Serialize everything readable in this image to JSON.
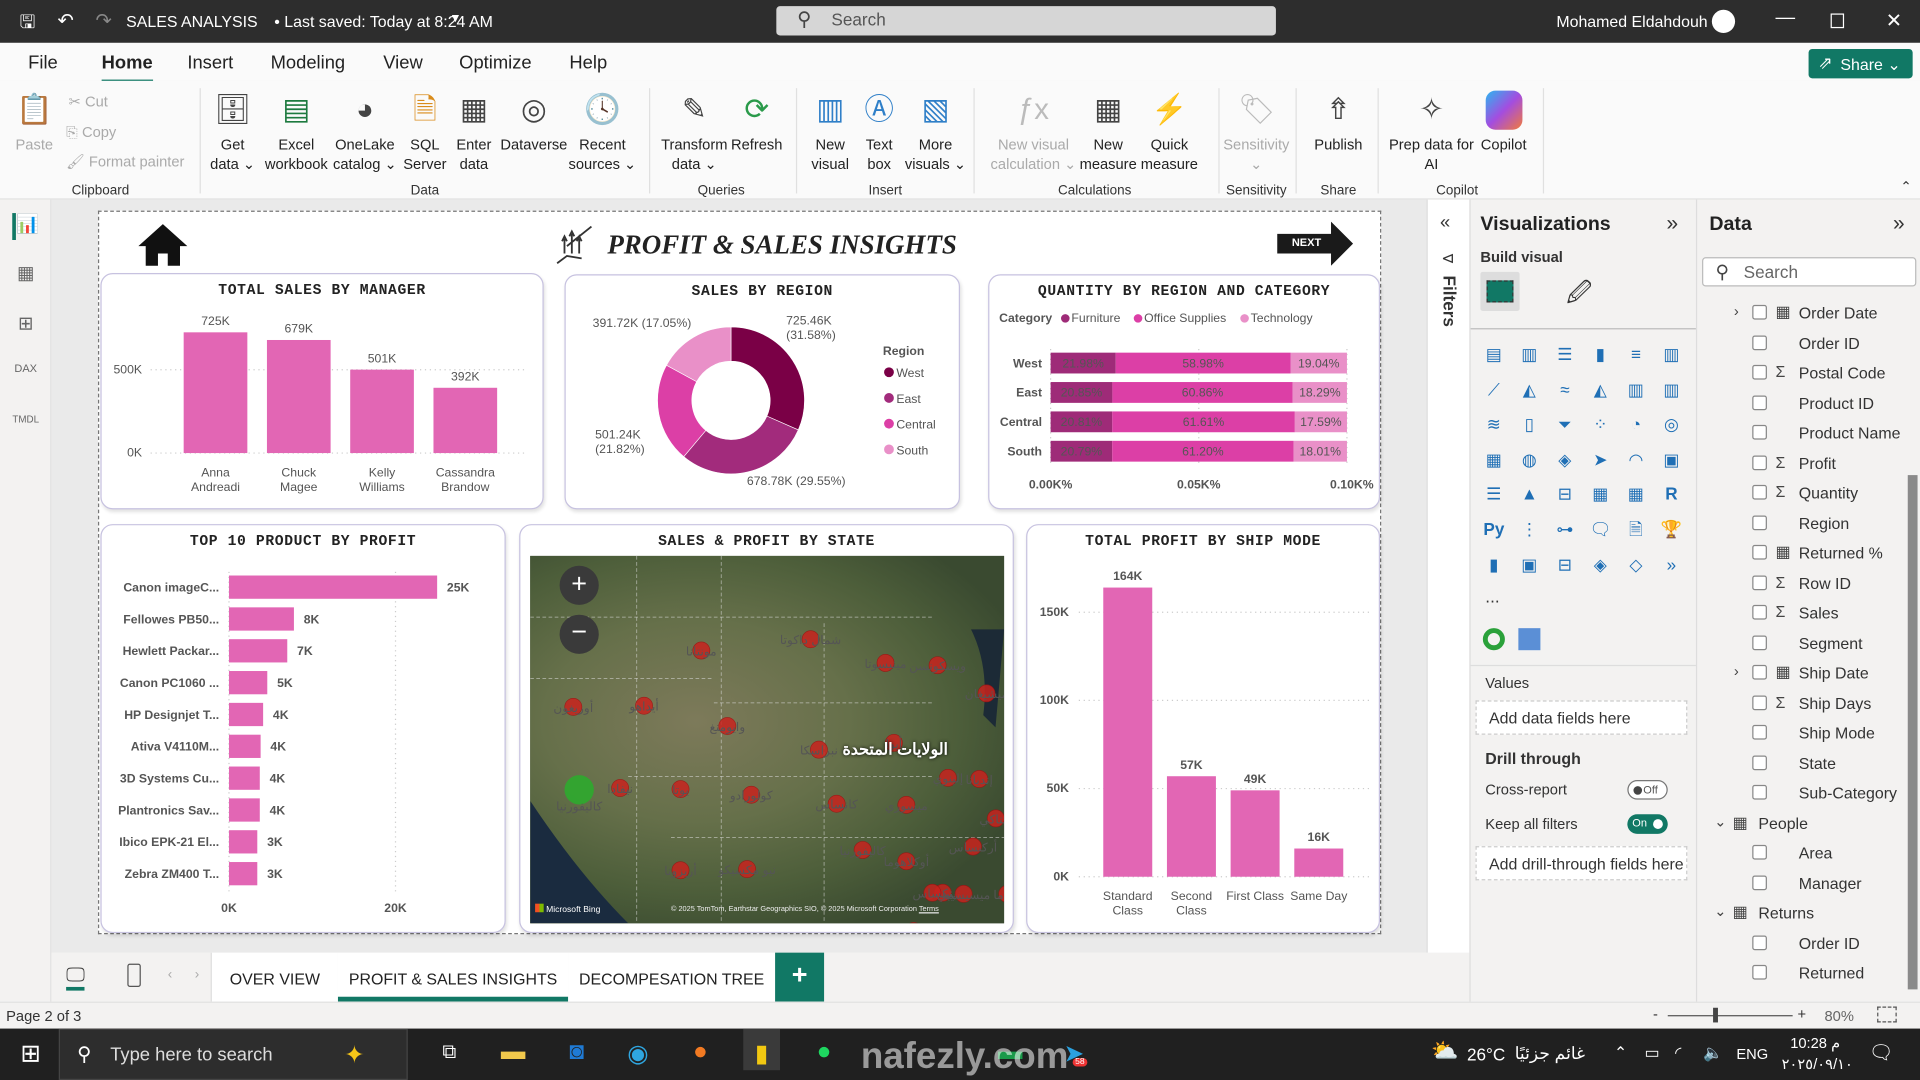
{
  "titlebar": {
    "title": "SALES ANALYSIS",
    "saved": "• Last saved: Today at 8:24 AM",
    "search_placeholder": "Search",
    "user": "Mohamed Eldahdouh"
  },
  "menu": {
    "items": [
      "File",
      "Home",
      "Insert",
      "Modeling",
      "View",
      "Optimize",
      "Help"
    ],
    "active": "Home",
    "share": "Share"
  },
  "ribbon": {
    "clipboard": {
      "paste": "Paste",
      "cut": "Cut",
      "copy": "Copy",
      "format_painter": "Format painter",
      "label": "Clipboard"
    },
    "data": {
      "get_data": "Get\ndata ⌄",
      "excel": "Excel\nworkbook",
      "onelake": "OneLake\ncatalog ⌄",
      "sql": "SQL\nServer",
      "enter": "Enter\ndata",
      "dataverse": "Dataverse",
      "recent": "Recent\nsources ⌄",
      "label": "Data"
    },
    "queries": {
      "transform": "Transform\ndata ⌄",
      "refresh": "Refresh",
      "label": "Queries"
    },
    "insert": {
      "new_visual": "New\nvisual",
      "text_box": "Text\nbox",
      "more_visuals": "More\nvisuals ⌄",
      "label": "Insert"
    },
    "calculations": {
      "new_visual_calc": "New visual\ncalculation ⌄",
      "new_measure": "New\nmeasure",
      "quick_measure": "Quick\nmeasure",
      "label": "Calculations"
    },
    "sensitivity": {
      "sensitivity": "Sensitivity\n⌄",
      "label": "Sensitivity"
    },
    "share": {
      "publish": "Publish",
      "label": "Share"
    },
    "copilot": {
      "prep": "Prep data for\nAI",
      "copilot": "Copilot",
      "label": "Copilot"
    }
  },
  "report": {
    "title": "PROFIT & SALES INSIGHTS",
    "next_button": "NEXT",
    "accent": "#e266b4"
  },
  "chart_data": [
    {
      "type": "bar",
      "title": "TOTAL SALES BY MANAGER",
      "categories": [
        "Anna\nAndreadi",
        "Chuck\nMagee",
        "Kelly\nWilliams",
        "Cassandra\nBrandow"
      ],
      "values": [
        725,
        679,
        501,
        392
      ],
      "data_labels": [
        "725K",
        "679K",
        "501K",
        "392K"
      ],
      "yticks": [
        "0K",
        "500K"
      ],
      "ylim": [
        0,
        800
      ],
      "unit": "K",
      "color": "#e266b4"
    },
    {
      "type": "pie",
      "title": "SALES BY REGION",
      "legend_title": "Region",
      "categories": [
        "West",
        "East",
        "Central",
        "South"
      ],
      "values": [
        725.46,
        678.78,
        501.24,
        391.72
      ],
      "percents": [
        31.58,
        29.55,
        21.82,
        17.05
      ],
      "data_labels": [
        "725.46K\n(31.58%)",
        "678.78K (29.55%)",
        "501.24K\n(21.82%)",
        "391.72K (17.05%)"
      ],
      "colors": [
        "#7a0046",
        "#a22b7c",
        "#dc3fa6",
        "#e990c8"
      ],
      "donut": true,
      "legend": "right"
    },
    {
      "type": "bar",
      "stacked": "100%",
      "orientation": "horizontal",
      "title": "QUANTITY BY REGION AND CATEGORY",
      "legend_title": "Category",
      "categories": [
        "West",
        "East",
        "Central",
        "South"
      ],
      "series": [
        {
          "name": "Furniture",
          "values": [
            21.98,
            20.85,
            20.81,
            20.79
          ],
          "color": "#9e2b78"
        },
        {
          "name": "Office Supplies",
          "values": [
            58.98,
            60.86,
            61.61,
            61.2
          ],
          "color": "#dc3fa6"
        },
        {
          "name": "Technology",
          "values": [
            19.04,
            18.29,
            17.59,
            18.01
          ],
          "color": "#e990c8"
        }
      ],
      "xticks": [
        "0.00K%",
        "0.05K%",
        "0.10K%"
      ],
      "legend": "top-left"
    },
    {
      "type": "bar",
      "orientation": "horizontal",
      "title": "TOP 10 PRODUCT BY PROFIT",
      "categories": [
        "Canon imageC...",
        "Fellowes PB50...",
        "Hewlett Packar...",
        "Canon PC1060 ...",
        "HP Designjet T...",
        "Ativa V4110M...",
        "3D Systems Cu...",
        "Plantronics Sav...",
        "Ibico EPK-21 El...",
        "Zebra ZM400 T..."
      ],
      "values": [
        25,
        7.8,
        7,
        4.6,
        4.1,
        3.8,
        3.7,
        3.7,
        3.4,
        3.4
      ],
      "data_labels": [
        "25K",
        "8K",
        "7K",
        "5K",
        "4K",
        "4K",
        "4K",
        "4K",
        "3K",
        "3K"
      ],
      "xticks": [
        "0K",
        "20K"
      ],
      "xlim": [
        0,
        27
      ],
      "color": "#e266b4"
    },
    {
      "type": "bar",
      "title": "TOTAL PROFIT BY SHIP MODE",
      "categories": [
        "Standard\nClass",
        "Second\nClass",
        "First Class",
        "Same Day"
      ],
      "values": [
        164,
        57,
        49,
        16
      ],
      "data_labels": [
        "164K",
        "57K",
        "49K",
        "16K"
      ],
      "yticks": [
        "0K",
        "50K",
        "100K",
        "150K"
      ],
      "ylim": [
        0,
        170
      ],
      "color": "#e266b4"
    }
  ],
  "map": {
    "title": "SALES & PROFIT BY STATE",
    "country_label": "الولايات المتحدة",
    "state_labels": [
      "شمال داكوتا",
      "مينيسوتا",
      "ويسكونسن",
      "ميشيغان",
      "مونتانا",
      "أوريغون",
      "أيداهو",
      "وايومنغ",
      "نبراسكا",
      "أيوا",
      "إلينوي",
      "إنديانا",
      "نيفادا",
      "يوتا",
      "كولورادو",
      "كانساس",
      "ميسوري",
      "كنتاكي",
      "كاليفورنيا",
      "أوكلاهوما",
      "أركنساس",
      "تينيسي",
      "أريزونا",
      "نيو مكسيكو",
      "تكساس",
      "ميسيسيبي",
      "ألاباما",
      "جورجيا",
      "لويزيانا"
    ],
    "attribution": "© 2025 TomTom, Earthstar Geographics SIO, © 2025 Microsoft Corporation",
    "terms": "Terms",
    "provider": "Microsoft Bing",
    "bubble_colors": {
      "loss": "#c8231e",
      "profit": "#2eaa2e"
    }
  },
  "filters": {
    "label": "Filters"
  },
  "visualizations": {
    "title": "Visualizations",
    "build_visual": "Build visual",
    "more": "...",
    "values_label": "Values",
    "values_well": "Add data fields here",
    "drill_through": "Drill through",
    "cross_report": "Cross-report",
    "cross_report_state": "Off",
    "keep_filters": "Keep all filters",
    "keep_filters_state": "On",
    "drill_well": "Add drill-through fields here",
    "icons": [
      "stacked-bar",
      "stacked-column",
      "clustered-bar",
      "clustered-column",
      "100-stacked-bar",
      "100-stacked-column",
      "line",
      "area",
      "stacked-area",
      "100-stacked-area",
      "line-column",
      "line-clustered-column",
      "ribbon",
      "waterfall",
      "funnel",
      "scatter",
      "pie",
      "donut",
      "treemap",
      "map",
      "filled-map",
      "azure-map",
      "gauge",
      "card",
      "multi-row-card",
      "kpi",
      "slicer",
      "table",
      "matrix",
      "r-visual",
      "python-visual",
      "key-influencers",
      "decomposition-tree",
      "qa",
      "smart-narrative",
      "paginated",
      "metrics",
      "card-new",
      "slicer-new",
      "arcgis",
      "power-apps",
      "power-automate"
    ]
  },
  "data_pane": {
    "title": "Data",
    "search_placeholder": "Search",
    "fields": [
      {
        "label": "Order Date",
        "icon": "calendar",
        "expand": "right"
      },
      {
        "label": "Order ID",
        "icon": ""
      },
      {
        "label": "Postal Code",
        "icon": "sigma"
      },
      {
        "label": "Product ID",
        "icon": ""
      },
      {
        "label": "Product Name",
        "icon": ""
      },
      {
        "label": "Profit",
        "icon": "sigma"
      },
      {
        "label": "Quantity",
        "icon": "sigma"
      },
      {
        "label": "Region",
        "icon": ""
      },
      {
        "label": "Returned %",
        "icon": "calculator"
      },
      {
        "label": "Row ID",
        "icon": "sigma"
      },
      {
        "label": "Sales",
        "icon": "sigma"
      },
      {
        "label": "Segment",
        "icon": ""
      },
      {
        "label": "Ship Date",
        "icon": "calendar",
        "expand": "right"
      },
      {
        "label": "Ship Days",
        "icon": "sigma"
      },
      {
        "label": "Ship Mode",
        "icon": ""
      },
      {
        "label": "State",
        "icon": ""
      },
      {
        "label": "Sub-Category",
        "icon": ""
      },
      {
        "label": "People",
        "icon": "table",
        "expand": "down",
        "table": true
      },
      {
        "label": "Area",
        "icon": ""
      },
      {
        "label": "Manager",
        "icon": ""
      },
      {
        "label": "Returns",
        "icon": "table",
        "expand": "down",
        "table": true
      },
      {
        "label": "Order ID",
        "icon": ""
      },
      {
        "label": "Returned",
        "icon": ""
      }
    ]
  },
  "page_tabs": {
    "tabs": [
      "OVER VIEW",
      "PROFIT & SALES INSIGHTS",
      "DECOMPESATION TREE"
    ],
    "active": 1,
    "add": "+"
  },
  "status": {
    "page": "Page 2 of 3",
    "zoom": "80%",
    "zoom_level": 80
  },
  "taskbar": {
    "search_placeholder": "Type here to search",
    "weather_temp": "26°C",
    "weather_text": "غائم جزئيًا",
    "language": "ENG",
    "time": "10:28 م",
    "date": "٢٠٢٥/٠٩/١٠",
    "telegram_badge": "58",
    "notification_badge": "٢",
    "watermark": "nafezly.com"
  }
}
